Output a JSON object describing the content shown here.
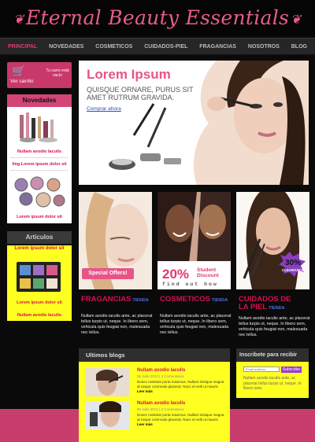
{
  "site": {
    "logo": "Eternal Beauty Essentials"
  },
  "nav": [
    {
      "label": "PRINCIPAL",
      "active": true
    },
    {
      "label": "NOVEDADES",
      "active": false
    },
    {
      "label": "COSMETICOS",
      "active": false
    },
    {
      "label": "CUIDADOS-PIEL",
      "active": false
    },
    {
      "label": "FRAGANCIAS",
      "active": false
    },
    {
      "label": "NOSOTROS",
      "active": false
    },
    {
      "label": "BLOG",
      "active": false
    }
  ],
  "cart": {
    "label": "Ver carrito",
    "note": "Tu carro está vacío"
  },
  "novedades": {
    "title": "Novedades",
    "items": [
      {
        "caption": "Nullam avodio Iaculis"
      },
      {
        "caption": "Img Lorem ipsum dolor sit"
      },
      {
        "caption": "Lorem ipsum dolor sit"
      }
    ]
  },
  "articulos": {
    "title": "Articulos",
    "marquee": "Lorem ipsum dolor sit",
    "items": [
      {
        "caption": "Lorem ipsum dolor sit"
      },
      {
        "caption": "Nullam avodio Iaculis"
      }
    ]
  },
  "banner": {
    "title": "Lorem Ipsum",
    "subtitle": "QUISQUE ORNARE, PURUS SIT AMET RUTRUM GRAVIDA.",
    "link": "Comprar ahora"
  },
  "tiles": {
    "offers": "Special Offers!",
    "discount_pct": "20%",
    "discount_label": "Student Discount",
    "find_out": "find out how",
    "clearance_pct": "30%",
    "clearance_label": "CLEARANCE"
  },
  "columns": [
    {
      "title": "FRAGANCIAS",
      "tag": "TIENDA",
      "text": "Nullam avodio iaculis ante, ac placerat tellus turpis ut, neque. In libero sem, vehicula quis feugiat non, malesuada nec tellus."
    },
    {
      "title": "COSMETICOS",
      "tag": "TIENDA",
      "text": "Nullam avodio iaculis ante, ac placerat tellus turpis ut, neque. In libero sem, vehicula quis feugiat non, malesuada nec tellus."
    },
    {
      "title": "CUIDADOS DE LA PIEL",
      "tag": "TIENDA",
      "text": "Nullam avodio iaculis ante, ac placerat tellus turpis ut, neque. In libero sem, vehicula quis feugiat non, malesuada nec tellus."
    }
  ],
  "blog": {
    "title": "Ultimos blogs",
    "posts": [
      {
        "title": "Nullam avodio Iaculis",
        "meta": "05 Julio 2013 | 3 Comentarios",
        "text": "Donec molestie porta maximus. Nullam tristique magna at neque commodo placerat. Nunc et velit ut mauris",
        "more": "Leer más"
      },
      {
        "title": "Nullam avodio Iaculis",
        "meta": "05 Julio 2013 | 3 Comentarios",
        "text": "Donec molestie porta maximus. Nullam tristique magna at neque commodo placerat. Nunc et velit ut mauris",
        "more": "Leer más"
      }
    ]
  },
  "inscribe": {
    "title": "Inscribete para recibir",
    "placeholder": "Email address",
    "button": "Subscribe",
    "text": "Nullam avodio iaculis ante, ac placerat tellus turpis ut, neque. In libero sem."
  }
}
